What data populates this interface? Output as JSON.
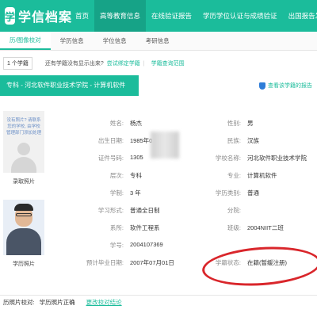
{
  "header": {
    "logo_text": "学信档案",
    "logo_mark": "学",
    "nav": [
      {
        "label": "首页",
        "active": false
      },
      {
        "label": "高等教育信息",
        "active": true
      },
      {
        "label": "在线验证报告",
        "active": false
      },
      {
        "label": "学历学位认证与成绩验证",
        "active": false
      },
      {
        "label": "出国报告发",
        "active": false
      }
    ]
  },
  "subtabs": [
    {
      "label": "历/图像校对",
      "active": true
    },
    {
      "label": "学历信息",
      "active": false
    },
    {
      "label": "学位信息",
      "active": false
    },
    {
      "label": "考研信息",
      "active": false
    }
  ],
  "count_row": {
    "count": "1 个学籍",
    "question": "还有学籍没有显示出来?",
    "bind_link": "尝试绑定学籍",
    "query_link": "学籍查询范围"
  },
  "record": {
    "title": "专科 - 河北软件职业技术学院 - 计算机软件",
    "report_link": "查看该学籍的报告"
  },
  "photos": {
    "hint": "没有照片? 请联系您的学校, 由学校管理部门添加处理",
    "enroll_caption": "录取照片",
    "degree_caption": "学历照片"
  },
  "fields_left": [
    {
      "label": "姓名:",
      "value": "杨杰"
    },
    {
      "label": "出生日期:",
      "value": "1985年0"
    },
    {
      "label": "证件号码:",
      "value": "1305"
    },
    {
      "label": "层次:",
      "value": "专科"
    },
    {
      "label": "学制:",
      "value": "3 年"
    },
    {
      "label": "学习形式:",
      "value": "普通全日制"
    },
    {
      "label": "系所:",
      "value": "软件工程系"
    },
    {
      "label": "学号:",
      "value": "2004107369"
    },
    {
      "label": "预计毕业日期:",
      "value": "2007年07月01日"
    }
  ],
  "fields_right": [
    {
      "label": "性别:",
      "value": "男"
    },
    {
      "label": "民族:",
      "value": "汉族"
    },
    {
      "label": "学校名称:",
      "value": "河北软件职业技术学院"
    },
    {
      "label": "专业:",
      "value": "计算机软件"
    },
    {
      "label": "学历类别:",
      "value": "普通"
    },
    {
      "label": "分院:",
      "value": ""
    },
    {
      "label": "班级:",
      "value": "2004NIIT二班"
    },
    {
      "label": "",
      "value": ""
    },
    {
      "label": "学籍状态:",
      "value": "在籍(暂缓注册)"
    }
  ],
  "footer": {
    "label": "历照片校对:",
    "value": "学历照片正确",
    "action": "更改校对结论"
  },
  "colors": {
    "brand": "#1bbc9b",
    "annotation_circle": "#d9262b"
  }
}
